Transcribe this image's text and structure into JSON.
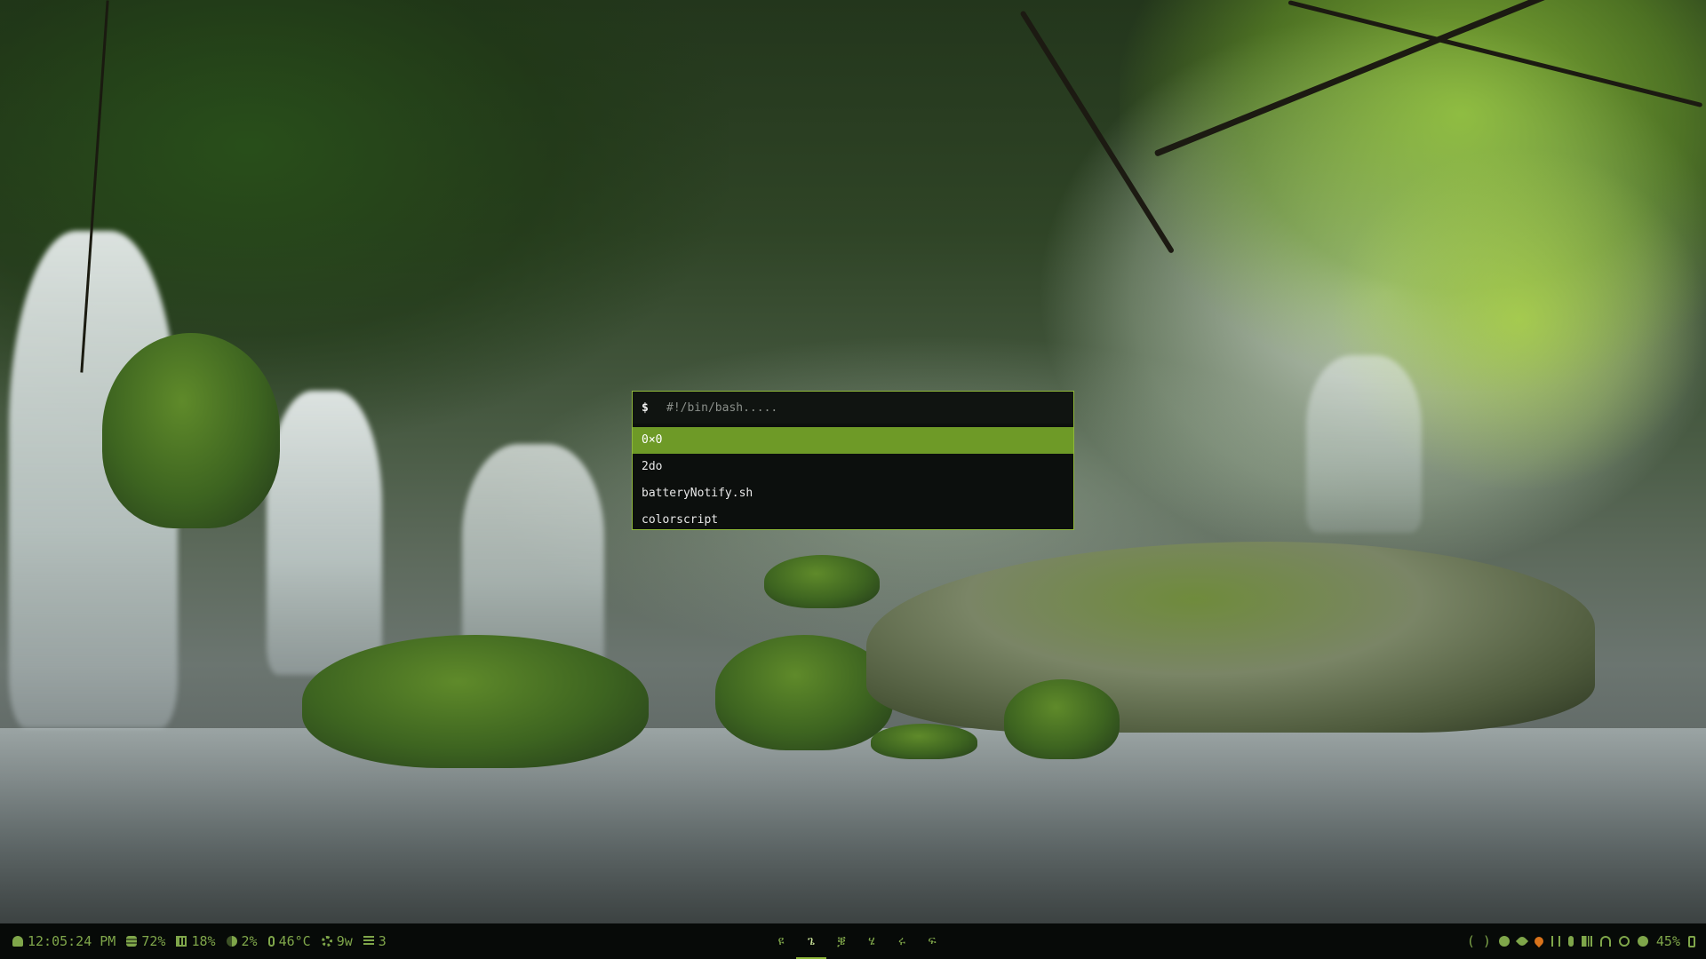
{
  "launcher": {
    "prompt": "$",
    "placeholder": "#!/bin/bash.....",
    "results": [
      "0×0",
      "2do",
      "batteryNotify.sh",
      "colorscript"
    ],
    "selected_index": 0
  },
  "status_bar": {
    "left": {
      "clock": "12:05:24 PM",
      "disk": "72%",
      "memory": "18%",
      "cpu": "2%",
      "temperature": "46°C",
      "power": "9w",
      "tasks": "3"
    },
    "workspaces": [
      "ዩ",
      "ጌ",
      "ቜ",
      "ሄ",
      "ሩ",
      "ፍ"
    ],
    "active_workspace_index": 1,
    "right": {
      "bracket_open": "(",
      "bracket_close": ")",
      "battery": "45%",
      "tray_icons": [
        "record-dot-icon",
        "eye-off-icon",
        "fire-icon",
        "bluetooth-icon",
        "microphone-icon",
        "speaker-icon",
        "wifi-icon",
        "globe-icon",
        "check-circle-icon",
        "battery-icon"
      ]
    }
  },
  "colors": {
    "accent": "#8fb83a",
    "selected_bg": "#6e9a27",
    "bar_bg": "#070a08",
    "bar_fg": "#7fa64a",
    "launcher_bg": "#0c0f0d",
    "warning": "#d9731b"
  }
}
